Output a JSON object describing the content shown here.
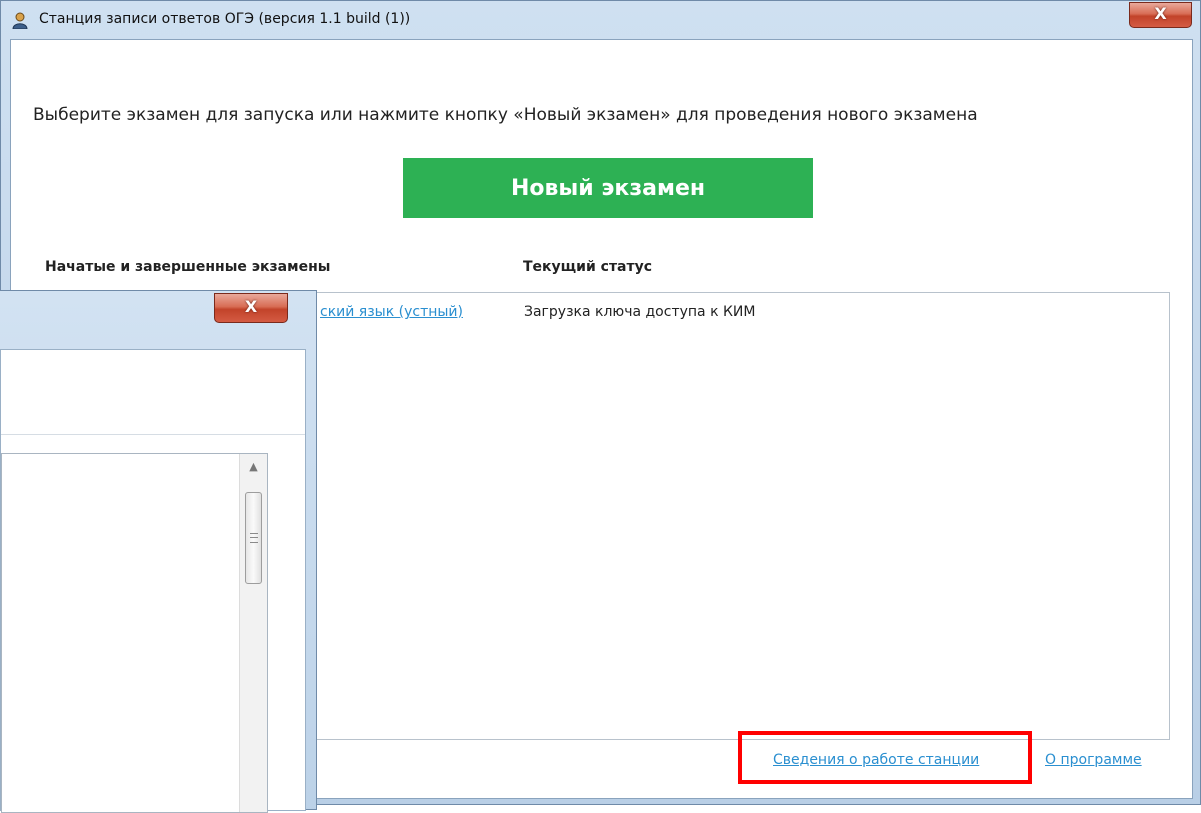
{
  "window": {
    "title": "Станция записи ответов ОГЭ (версия 1.1 build (1))",
    "close_glyph": "X"
  },
  "main": {
    "instruction": "Выберите экзамен для запуска или нажмите кнопку «Новый экзамен» для проведения нового экзамена",
    "new_exam_button": "Новый экзамен",
    "columns": {
      "exams": "Начатые и завершенные экзамены",
      "status": "Текущий статус"
    },
    "exams": [
      {
        "name": "ский язык (устный)",
        "status": "Загрузка ключа доступа к КИМ"
      }
    ],
    "links": {
      "station_info": "Сведения о работе станции",
      "about": "О программе"
    }
  },
  "dialog": {
    "close_glyph": "X",
    "scroll_up_glyph": "▲"
  },
  "colors": {
    "accent_green": "#2db154",
    "link_blue": "#2a8fd0",
    "highlight_red": "#ff0000",
    "close_red": "#c9482f"
  },
  "icons": {
    "app": "user-avatar-icon",
    "close": "close-icon",
    "scroll_up": "chevron-up-icon"
  }
}
